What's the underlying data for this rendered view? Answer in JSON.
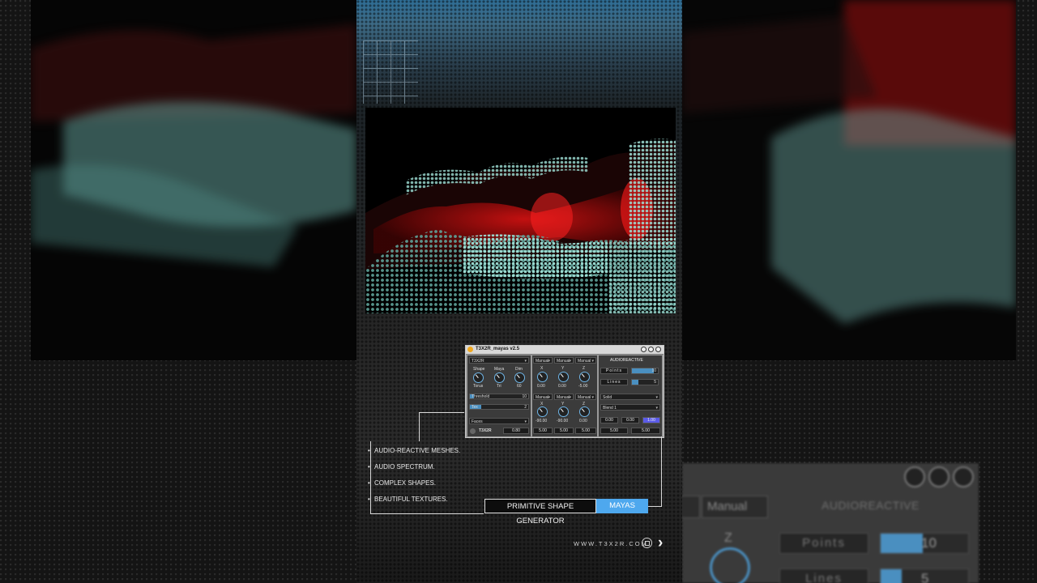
{
  "plugin": {
    "title": "T3X2R_mayas v2.5",
    "preset": "T3X2R",
    "shape_label": "Shape",
    "shape_value": "Torus",
    "maya_label": "Maya",
    "maya_value": "Tri",
    "dim_label": "Dim",
    "dim_value": "60",
    "threshold_label": "Threshold",
    "threshold_value": "10",
    "slider2_label": "Tex",
    "slider2_value": "2",
    "faces_label": "Faces",
    "t3x2r_label": "T3X2R",
    "t3x2r_value": "0.80",
    "manual_labels": [
      "Manual",
      "Manual",
      "Manual"
    ],
    "xyz_labels": [
      "X",
      "Y",
      "Z"
    ],
    "top_xyz_values": [
      "0.00",
      "0.00",
      "-5.00"
    ],
    "manual_labels_2": [
      "Manual",
      "Manual",
      "Manual"
    ],
    "rot_values": [
      "-90.00",
      "-90.00",
      "0.00"
    ],
    "scale_values": [
      "5.00",
      "5.00",
      "5.00"
    ],
    "audioreactive_title": "AUDIOREACTIVE",
    "points_label": "Points",
    "points_value": "10",
    "points_fill": 0.8,
    "lines_label": "Lines",
    "lines_value": "5",
    "lines_fill": 0.25,
    "render_mode": "Solid",
    "blend_mode": "Blend 1",
    "color_values": [
      "0.00",
      "0.00",
      "1.00"
    ],
    "bottom_values": [
      "5.00",
      "5.00"
    ]
  },
  "features": [
    "AUDIO-REACTIVE  MESHES.",
    "AUDIO SPECTRUM.",
    "COMPLEX SHAPES.",
    "BEAUTIFUL TEXTURES."
  ],
  "tags": {
    "primitive": "PRIMITIVE SHAPE GENERATOR",
    "mayas": "MAYAS"
  },
  "url": "WWW.T3X2R.COM",
  "ghost": {
    "manual_1": "Manual",
    "manual_2": "Manual",
    "audioreactive": "AUDIOREACTIVE",
    "points": "Points",
    "points_value": "10",
    "lines": "Lines",
    "lines_value": "5",
    "z_label": "Z"
  },
  "colors": {
    "accent_blue": "#4ea8ee",
    "mesh_teal": "#8fd6cf",
    "mesh_red": "#c81010"
  }
}
